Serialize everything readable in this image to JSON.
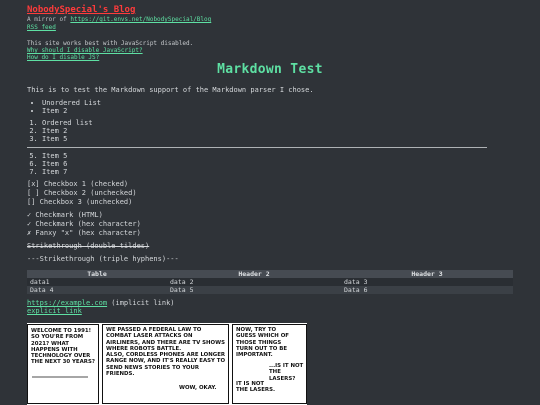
{
  "header": {
    "site_title": "NobodySpecial's Blog",
    "mirror_prefix": "A mirror of ",
    "mirror_url": "https://git.envs.net/NobodySpecial/Blog",
    "rss": "RSS feed",
    "js_note": "This site works best with JavaScript disabled.",
    "js_why": "Why should I disable JavaScript?",
    "js_how": "How do I disable JS?"
  },
  "page": {
    "title": "Markdown Test",
    "intro": "This is to test the Markdown support of the Markdown parser I chose."
  },
  "unordered": [
    "Unordered List",
    "Item 2"
  ],
  "ordered_a": [
    "Ordered list",
    "Item 2",
    "Item 5"
  ],
  "ordered_b": [
    "Item 5",
    "Item 6",
    "Item 7"
  ],
  "checkboxes": [
    "[x] Checkbox 1 (checked)",
    "[ ] Checkbox 2 (unchecked)",
    "[] Checkbox 3 (unchecked)"
  ],
  "checkmarks": [
    "✓ Checkmark (HTML)",
    "✓ Checkmark (hex character)",
    "✗ Fanxy \"x\" (hex character)"
  ],
  "strike_tilde": "Strikethrough (double tildes)",
  "strike_hyphen": "---Strikethrough (triple hyphens)---",
  "table": {
    "headers": [
      "Table",
      "Header 2",
      "Header 3"
    ],
    "rows": [
      [
        "data1",
        "data 2",
        "data 3"
      ],
      [
        "Data 4",
        "Data 5",
        "Data 6"
      ]
    ]
  },
  "links": {
    "implicit_url": "https://example.com",
    "implicit_suffix": " (implicit link)",
    "explicit": "explicit link"
  },
  "comic": {
    "panel1": "Welcome to 1991! So you're from 2021? What happens with technology over the next 30 years?",
    "panel2a": "We passed a federal law to combat laser attacks on airliners, and there are TV shows where robots battle.",
    "panel2b": "Also, cordless phones are longer range now, and it's really easy to send news stories to your friends.",
    "panel2c": "Wow, okay.",
    "panel3a": "Now, try to guess which of those things turn out to be important.",
    "panel3b": "...Is it not the lasers?",
    "panel3c": "It is not the lasers."
  }
}
